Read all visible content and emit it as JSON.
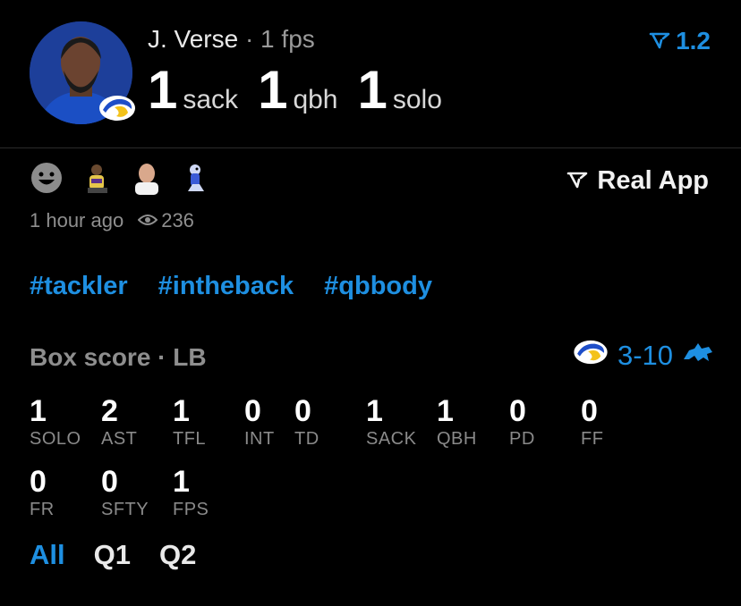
{
  "player": {
    "name": "J. Verse",
    "sub": "· 1 fps",
    "avatar_icon": "player-headshot",
    "team_badge_icon": "rams-logo",
    "stats": [
      {
        "num": "1",
        "label": "sack"
      },
      {
        "num": "1",
        "label": "qbh"
      },
      {
        "num": "1",
        "label": "solo"
      }
    ]
  },
  "rating": {
    "icon": "real-app-v-icon",
    "value": "1.2"
  },
  "reactions": [
    {
      "icon": "smiley-face-icon"
    },
    {
      "icon": "player-reaction-1"
    },
    {
      "icon": "bald-man-reaction"
    },
    {
      "icon": "cartoon-bird-reaction"
    }
  ],
  "real_app": {
    "icon": "real-app-v-icon",
    "label": "Real App"
  },
  "meta": {
    "time": "1 hour ago",
    "views": "236"
  },
  "tags": [
    "#tackler",
    "#intheback",
    "#qbbody"
  ],
  "box": {
    "header": "Box score · LB",
    "score": "3-10",
    "home_icon": "rams-logo",
    "away_icon": "lions-logo",
    "row1": [
      {
        "v": "1",
        "k": "SOLO"
      },
      {
        "v": "2",
        "k": "AST"
      },
      {
        "v": "1",
        "k": "TFL"
      },
      {
        "v": "0",
        "k": "INT"
      },
      {
        "v": "0",
        "k": "TD"
      },
      {
        "v": "1",
        "k": "SACK"
      },
      {
        "v": "1",
        "k": "QBH"
      },
      {
        "v": "0",
        "k": "PD"
      },
      {
        "v": "0",
        "k": "FF"
      }
    ],
    "row2": [
      {
        "v": "0",
        "k": "FR"
      },
      {
        "v": "0",
        "k": "SFTY"
      },
      {
        "v": "1",
        "k": "FPS"
      }
    ]
  },
  "quarters": {
    "tabs": [
      "All",
      "Q1",
      "Q2"
    ],
    "active": "All"
  },
  "colors": {
    "accent": "#1e8fe1",
    "background": "#000000",
    "muted": "#8f8f8f"
  }
}
